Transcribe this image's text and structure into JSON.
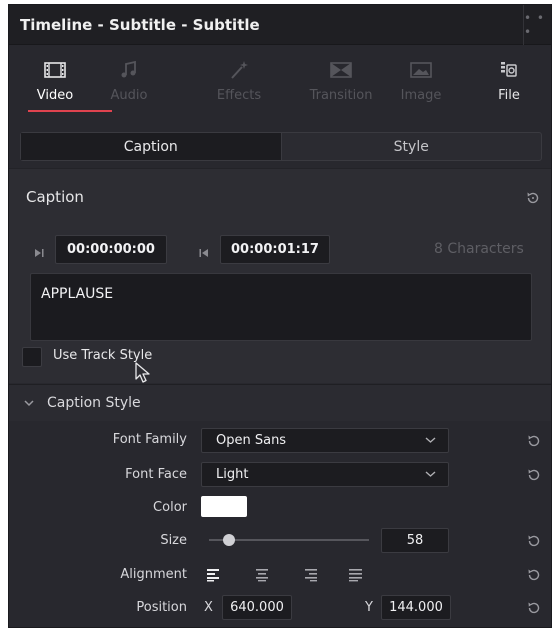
{
  "window": {
    "title": "Timeline - Subtitle - Subtitle",
    "menu_icon": "ellipsis-icon"
  },
  "inspector_tabs": [
    {
      "label": "Video",
      "icon": "video-icon",
      "active": true
    },
    {
      "label": "Audio",
      "icon": "audio-icon",
      "active": false
    },
    {
      "label": "Effects",
      "icon": "effects-icon",
      "active": false
    },
    {
      "label": "Transition",
      "icon": "transition-icon",
      "active": false
    },
    {
      "label": "Image",
      "icon": "image-icon",
      "active": false
    },
    {
      "label": "File",
      "icon": "file-icon",
      "active": false
    }
  ],
  "segments": {
    "caption": "Caption",
    "style": "Style",
    "selected": "Caption"
  },
  "caption": {
    "heading": "Caption",
    "in_timecode": "00:00:00:00",
    "out_timecode": "00:00:01:17",
    "char_count": "8 Characters",
    "text": "APPLAUSE",
    "use_track_style_label": "Use Track Style",
    "use_track_style_checked": false
  },
  "caption_style": {
    "heading": "Caption Style",
    "font_family_label": "Font Family",
    "font_family_value": "Open Sans",
    "font_face_label": "Font Face",
    "font_face_value": "Light",
    "color_label": "Color",
    "color_value": "#ffffff",
    "size_label": "Size",
    "size_value": "58",
    "alignment_label": "Alignment",
    "alignment_options": [
      "align-left-icon",
      "align-center-icon",
      "align-right-icon",
      "align-justify-icon"
    ],
    "alignment_selected": "align-left-icon",
    "position_label": "Position",
    "position_x_label": "X",
    "position_x_value": "640.000",
    "position_y_label": "Y",
    "position_y_value": "144.000"
  },
  "colors": {
    "accent": "#e0434f",
    "panel": "#28282e",
    "field": "#1c1c20"
  }
}
